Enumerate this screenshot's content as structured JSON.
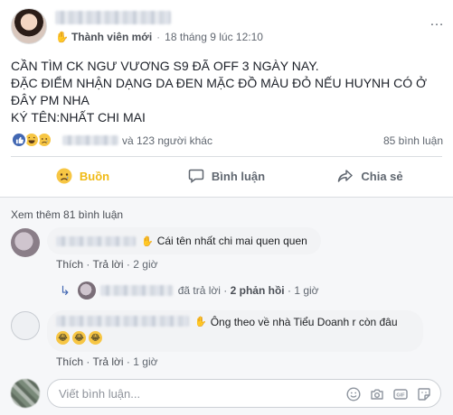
{
  "post": {
    "badge_label": "Thành viên mới",
    "timestamp": "18 tháng 9 lúc 12:10",
    "text_lines": [
      "CẦN TÌM CK NGƯ VƯƠNG S9 ĐÃ OFF 3 NGÀY NAY.",
      "ĐẶC ĐIỂM NHẬN DẠNG DA ĐEN MẶC ĐỒ MÀU ĐỎ NẾU HUYNH CÓ Ở",
      "ĐÂY PM NHA",
      "KÝ TÊN:NHẤT CHI MAI"
    ],
    "more_icon": "…"
  },
  "reactions": {
    "others_text": "và 123 người khác",
    "comment_count": "85 bình luận",
    "icons": [
      "like-icon",
      "haha-icon",
      "sad-icon"
    ]
  },
  "actions": {
    "reaction_label": "Buồn",
    "comment_label": "Bình luận",
    "share_label": "Chia sẻ",
    "active_color": "#f0ba15"
  },
  "comments": {
    "view_more": "Xem thêm 81 bình luận",
    "items": [
      {
        "text": "Cái tên nhất chi mai quen quen",
        "like_label": "Thích",
        "reply_label": "Trả lời",
        "time": "2 giờ"
      },
      {
        "text": "Ông theo về nhà Tiểu Doanh r còn đâu",
        "like_label": "Thích",
        "reply_label": "Trả lời",
        "time": "1 giờ"
      }
    ],
    "reply_summary": {
      "replied_text": "đã trả lời",
      "count_text": "2 phản hồi",
      "time": "1 giờ"
    }
  },
  "compose": {
    "placeholder": "Viết bình luận...",
    "icons": [
      "emoji-icon",
      "camera-icon",
      "gif-icon",
      "sticker-icon"
    ]
  },
  "colors": {
    "link_blue": "#4267b2",
    "text_gray": "#606770",
    "reaction_yellow": "#f0ba15"
  }
}
